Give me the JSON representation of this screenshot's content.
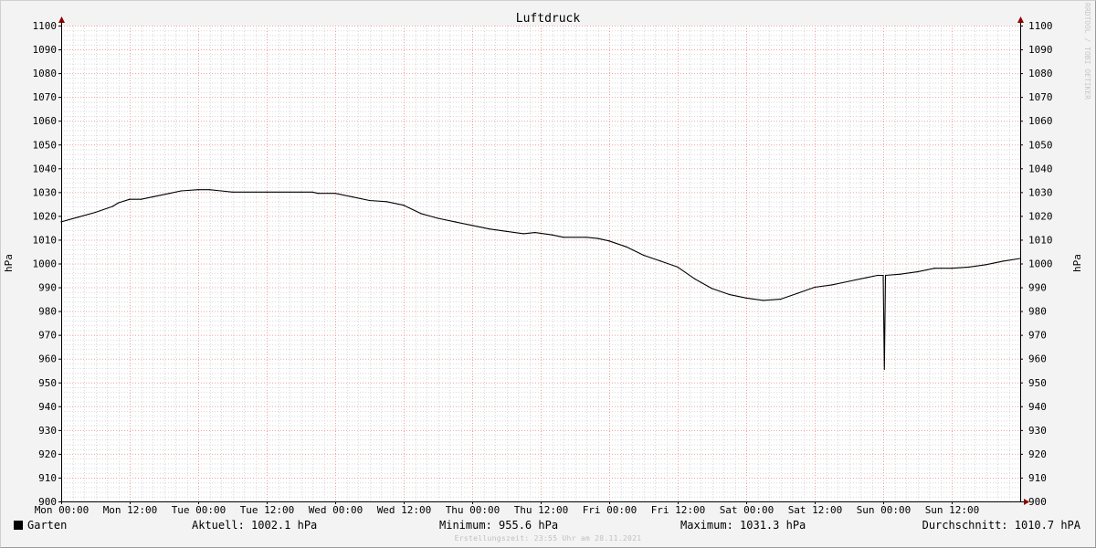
{
  "chart_data": {
    "type": "line",
    "title": "Luftdruck",
    "ylabel": "hPa",
    "ylim": [
      900,
      1100
    ],
    "y_ticks": [
      900,
      910,
      920,
      930,
      940,
      950,
      960,
      970,
      980,
      990,
      1000,
      1010,
      1020,
      1030,
      1040,
      1050,
      1060,
      1070,
      1080,
      1090,
      1100
    ],
    "x_ticks": [
      "Mon 00:00",
      "Mon 12:00",
      "Tue 00:00",
      "Tue 12:00",
      "Wed 00:00",
      "Wed 12:00",
      "Thu 00:00",
      "Thu 12:00",
      "Fri 00:00",
      "Fri 12:00",
      "Sat 00:00",
      "Sat 12:00",
      "Sun 00:00",
      "Sun 12:00"
    ],
    "x_unit": "hours since Mon 00:00",
    "xlim": [
      0,
      168
    ],
    "grid": true,
    "series": [
      {
        "name": "Garten",
        "color": "#000000",
        "points": [
          [
            0,
            1017.5
          ],
          [
            3,
            1019.5
          ],
          [
            6,
            1021.5
          ],
          [
            9,
            1024
          ],
          [
            10,
            1025.5
          ],
          [
            12,
            1027
          ],
          [
            14,
            1027
          ],
          [
            16,
            1028
          ],
          [
            19,
            1029.5
          ],
          [
            21,
            1030.5
          ],
          [
            24,
            1031
          ],
          [
            26,
            1031
          ],
          [
            28,
            1030.5
          ],
          [
            30,
            1030
          ],
          [
            36,
            1030
          ],
          [
            42,
            1030
          ],
          [
            44,
            1030
          ],
          [
            45,
            1029.5
          ],
          [
            48,
            1029.5
          ],
          [
            51,
            1028
          ],
          [
            54,
            1026.5
          ],
          [
            57,
            1026
          ],
          [
            60,
            1024.5
          ],
          [
            63,
            1021
          ],
          [
            66,
            1019
          ],
          [
            69,
            1017.5
          ],
          [
            72,
            1016
          ],
          [
            75,
            1014.5
          ],
          [
            78,
            1013.5
          ],
          [
            81,
            1012.5
          ],
          [
            83,
            1013
          ],
          [
            86,
            1012
          ],
          [
            88,
            1011
          ],
          [
            92,
            1011
          ],
          [
            94,
            1010.5
          ],
          [
            96,
            1009.5
          ],
          [
            99,
            1007
          ],
          [
            102,
            1003.5
          ],
          [
            105,
            1001
          ],
          [
            108,
            998.5
          ],
          [
            111,
            993.5
          ],
          [
            114,
            989.5
          ],
          [
            117,
            987
          ],
          [
            120,
            985.5
          ],
          [
            123,
            984.5
          ],
          [
            126,
            985
          ],
          [
            129,
            987.5
          ],
          [
            132,
            990
          ],
          [
            135,
            991
          ],
          [
            138,
            992.5
          ],
          [
            141,
            994
          ],
          [
            143,
            995
          ],
          [
            144,
            995
          ],
          [
            144.2,
            955.6
          ],
          [
            144.4,
            995
          ],
          [
            147,
            995.5
          ],
          [
            150,
            996.5
          ],
          [
            153,
            998
          ],
          [
            156,
            998
          ],
          [
            159,
            998.5
          ],
          [
            162,
            999.5
          ],
          [
            165,
            1001
          ],
          [
            168,
            1002.1
          ]
        ]
      }
    ]
  },
  "legend": {
    "series_label": "Garten",
    "swatch_color": "#000000",
    "current": "Aktuell: 1002.1 hPa",
    "minimum": "Minimum: 955.6 hPa",
    "maximum": "Maximum: 1031.3 hPa",
    "average": "Durchschnitt: 1010.7 hPA"
  },
  "footer_note": "Erstellungszeit: 23:55 Uhr am 28.11.2021",
  "watermark": "RRDTOOL / TOBI OETIKER",
  "colors": {
    "background": "#f3f3f3",
    "plot_background": "#ffffff",
    "minor_grid": "#d9d9d9",
    "major_grid": "#f0a0a0",
    "axis_arrow": "#8b0000"
  }
}
